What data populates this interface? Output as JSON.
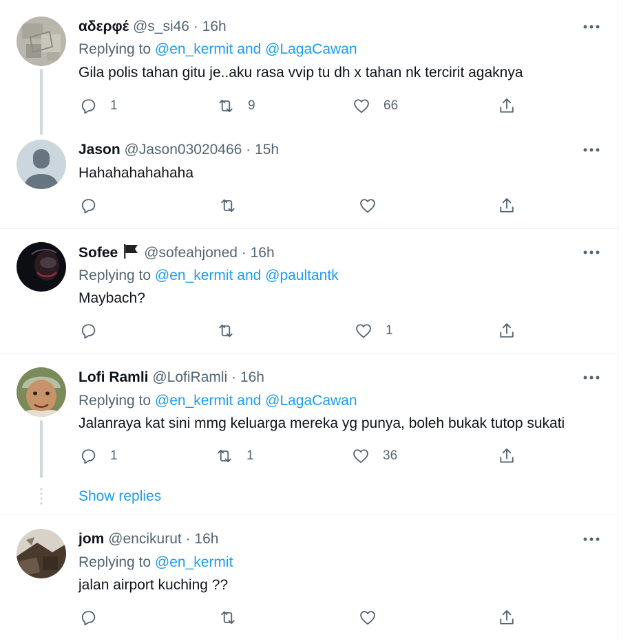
{
  "tweets": [
    {
      "name": "αδερφέ",
      "handle": "@s_si46",
      "time": "16h",
      "replying_prefix": "Replying to ",
      "replying_to": "@en_kermit and @LagaCawan",
      "text": "Gila polis tahan gitu je..aku rasa vvip tu dh x tahan nk tercirit agaknya",
      "replies": "1",
      "retweets": "9",
      "likes": "66"
    },
    {
      "name": "Jason",
      "handle": "@Jason03020466",
      "time": "15h",
      "text": "Hahahahahahaha",
      "replies": "",
      "retweets": "",
      "likes": ""
    },
    {
      "name": "Sofee",
      "handle": "@sofeahjoned",
      "time": "16h",
      "replying_prefix": "Replying to ",
      "replying_to": "@en_kermit and @paultantk",
      "text": "Maybach?",
      "replies": "",
      "retweets": "",
      "likes": "1"
    },
    {
      "name": "Lofi Ramli",
      "handle": "@LofiRamli",
      "time": "16h",
      "replying_prefix": "Replying to ",
      "replying_to": "@en_kermit and @LagaCawan",
      "text": "Jalanraya kat sini mmg keluarga mereka yg punya, boleh bukak tutop sukati",
      "replies": "1",
      "retweets": "1",
      "likes": "36",
      "show_replies": "Show replies"
    },
    {
      "name": "jom",
      "handle": "@encikurut",
      "time": "16h",
      "replying_prefix": "Replying to ",
      "replying_to": "@en_kermit",
      "text": "jalan airport kuching ??",
      "replies": "",
      "retweets": "",
      "likes": ""
    }
  ],
  "separator": " · ",
  "icons": {
    "more": "more-dots-icon",
    "reply": "reply-bubble-icon",
    "retweet": "retweet-arrows-icon",
    "like": "heart-icon",
    "share": "share-upload-icon",
    "flag": "black-flag-icon"
  },
  "colors": {
    "link": "#1d9bf0",
    "secondary_text": "#536471",
    "primary_text": "#0f1419",
    "divider": "#eff3f4",
    "thread_line": "#cfd9de"
  }
}
